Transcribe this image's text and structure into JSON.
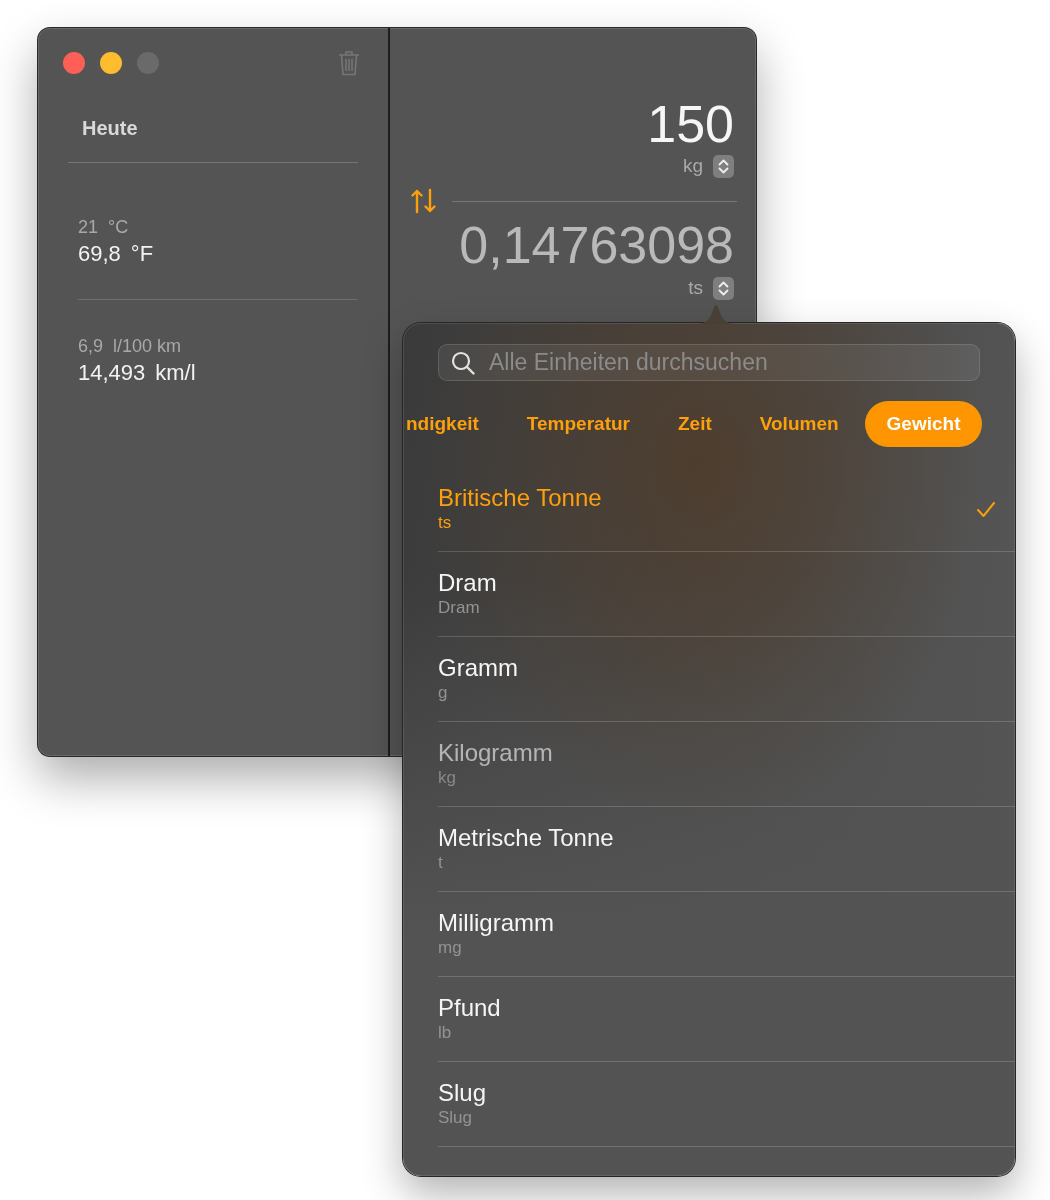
{
  "window": {
    "buttons": [
      {
        "kind": "close",
        "disabled": false
      },
      {
        "kind": "minimize",
        "disabled": false
      },
      {
        "kind": "zoom",
        "disabled": true
      }
    ]
  },
  "sidebar": {
    "title": "Heute",
    "history": [
      {
        "from_value": "21",
        "from_unit": "°C",
        "to_value": "69,8",
        "to_unit": "°F"
      },
      {
        "from_value": "6,9",
        "from_unit": "l/100 km",
        "to_value": "14,493",
        "to_unit": "km/l"
      }
    ]
  },
  "converter": {
    "input": {
      "value": "150",
      "unit": "kg"
    },
    "output": {
      "value": "0,14763098",
      "unit": "ts"
    }
  },
  "unit_picker": {
    "search": {
      "placeholder": "Alle Einheiten durchsuchen"
    },
    "categories": [
      {
        "label": "ndigkeit",
        "selected": false
      },
      {
        "label": "Temperatur",
        "selected": false
      },
      {
        "label": "Zeit",
        "selected": false
      },
      {
        "label": "Volumen",
        "selected": false
      },
      {
        "label": "Gewicht",
        "selected": true
      }
    ],
    "units": [
      {
        "name": "Britische Tonne",
        "symbol": "ts",
        "selected": true,
        "disabled": false
      },
      {
        "name": "Dram",
        "symbol": "Dram",
        "selected": false,
        "disabled": false
      },
      {
        "name": "Gramm",
        "symbol": "g",
        "selected": false,
        "disabled": false
      },
      {
        "name": "Kilogramm",
        "symbol": "kg",
        "selected": false,
        "disabled": true
      },
      {
        "name": "Metrische Tonne",
        "symbol": "t",
        "selected": false,
        "disabled": false
      },
      {
        "name": "Milligramm",
        "symbol": "mg",
        "selected": false,
        "disabled": false
      },
      {
        "name": "Pfund",
        "symbol": "lb",
        "selected": false,
        "disabled": false
      },
      {
        "name": "Slug",
        "symbol": "Slug",
        "selected": false,
        "disabled": false
      }
    ]
  }
}
